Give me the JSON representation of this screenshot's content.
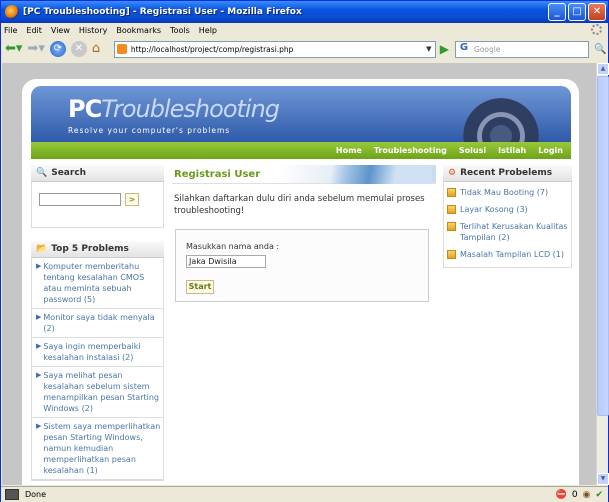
{
  "window": {
    "title": "[PC Troubleshooting] - Registrasi User - Mozilla Firefox"
  },
  "menu": [
    "File",
    "Edit",
    "View",
    "History",
    "Bookmarks",
    "Tools",
    "Help"
  ],
  "address": {
    "url": "http://localhost/project/comp/registrasi.php"
  },
  "search": {
    "engine": "G",
    "placeholder": "Google"
  },
  "site": {
    "logo_pc": "PC",
    "logo_ts": "Troubleshooting",
    "tagline": "Resolve your computer's problems",
    "nav": [
      "Home",
      "Troubleshooting",
      "Solusi",
      "Istilah",
      "Login"
    ]
  },
  "sidebar": {
    "search_title": "Search",
    "search_go": ">",
    "top5_title": "Top 5 Problems",
    "top5": [
      "Komputer memberitahu tentang kesalahan CMOS atau meminta sebuah password (5)",
      "Monitor saya tidak menyala (2)",
      "Saya ingin memperbaiki kesalahan instalasi (2)",
      "Saya melihat pesan kesalahan sebelum sistem menampilkan pesan Starting Windows (2)",
      "Sistem saya memperlihatkan pesan Starting Windows, namun kemudian memperlihatkan pesan kesalahan (1)"
    ]
  },
  "main": {
    "title": "Registrasi User",
    "intro": "Silahkan daftarkan dulu diri anda sebelum memulai proses troubleshooting!",
    "label": "Masukkan nama anda :",
    "name_value": "Jaka Dwisila",
    "start_button": "Start"
  },
  "recent": {
    "title": "Recent Probelems",
    "items": [
      "Tidak Mau Booting (7)",
      "Layar Kosong (3)",
      "Terlihat Kerusakan Kualitas Tampilan (2)",
      "Masalah Tampilan LCD (1)"
    ]
  },
  "status": {
    "text": "Done",
    "count": "0"
  }
}
